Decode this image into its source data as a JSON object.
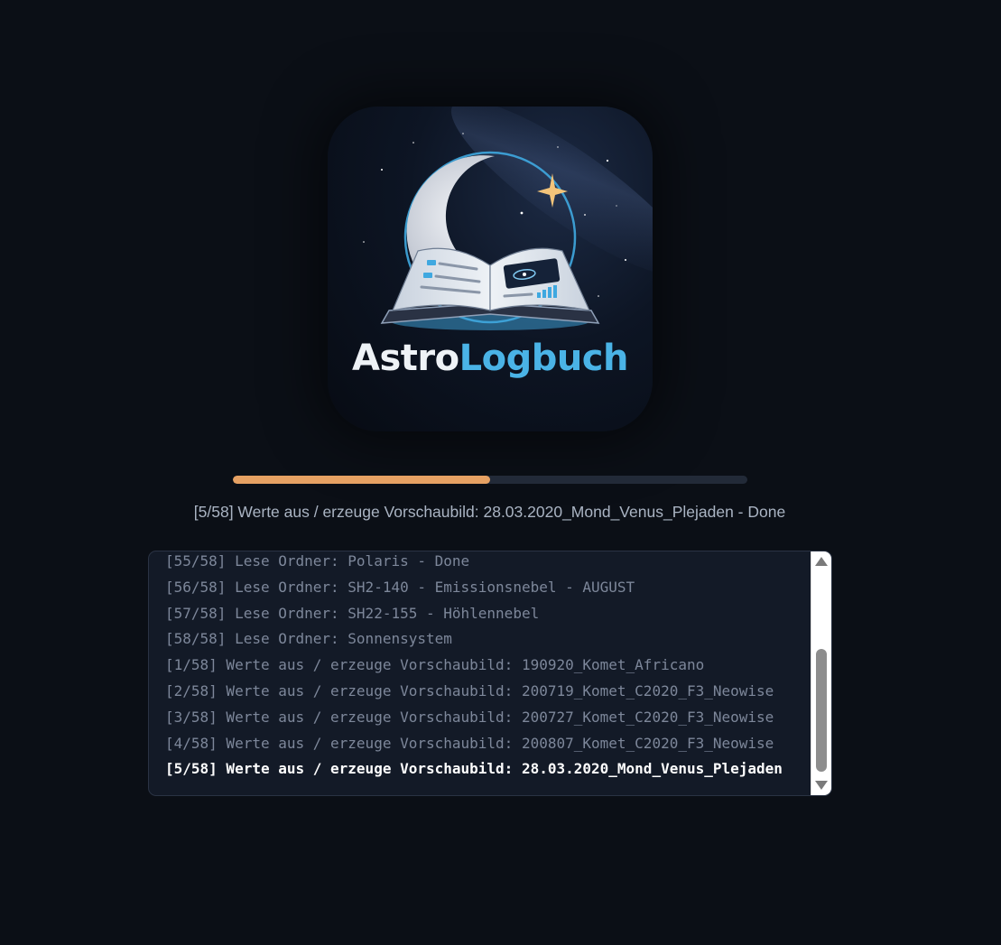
{
  "logo": {
    "text_part1": "Astro",
    "text_part2": "Logbuch",
    "icon": "moon-book-logo-icon"
  },
  "progress": {
    "value": 0.5
  },
  "status": {
    "text": "[5/58] Werte aus / erzeuge Vorschaubild: 28.03.2020_Mond_Venus_Plejaden - Done"
  },
  "log": {
    "lines": [
      "[55/58] Lese Ordner: Polaris - Done",
      "[56/58] Lese Ordner: SH2-140 - Emissionsnebel - AUGUST",
      "[57/58] Lese Ordner: SH22-155 - Höhlennebel",
      "[58/58] Lese Ordner: Sonnensystem",
      "[1/58] Werte aus / erzeuge Vorschaubild: 190920_Komet_Africano",
      "[2/58] Werte aus / erzeuge Vorschaubild: 200719_Komet_C2020_F3_Neowise",
      "[3/58] Werte aus / erzeuge Vorschaubild: 200727_Komet_C2020_F3_Neowise",
      "[4/58] Werte aus / erzeuge Vorschaubild: 200807_Komet_C2020_F3_Neowise",
      "[5/58] Werte aus / erzeuge Vorschaubild: 28.03.2020_Mond_Venus_Plejaden"
    ],
    "current_index": 8
  },
  "colors": {
    "background": "#0b0f16",
    "accent": "#e6a163",
    "logo_blue": "#4ab3e6"
  }
}
